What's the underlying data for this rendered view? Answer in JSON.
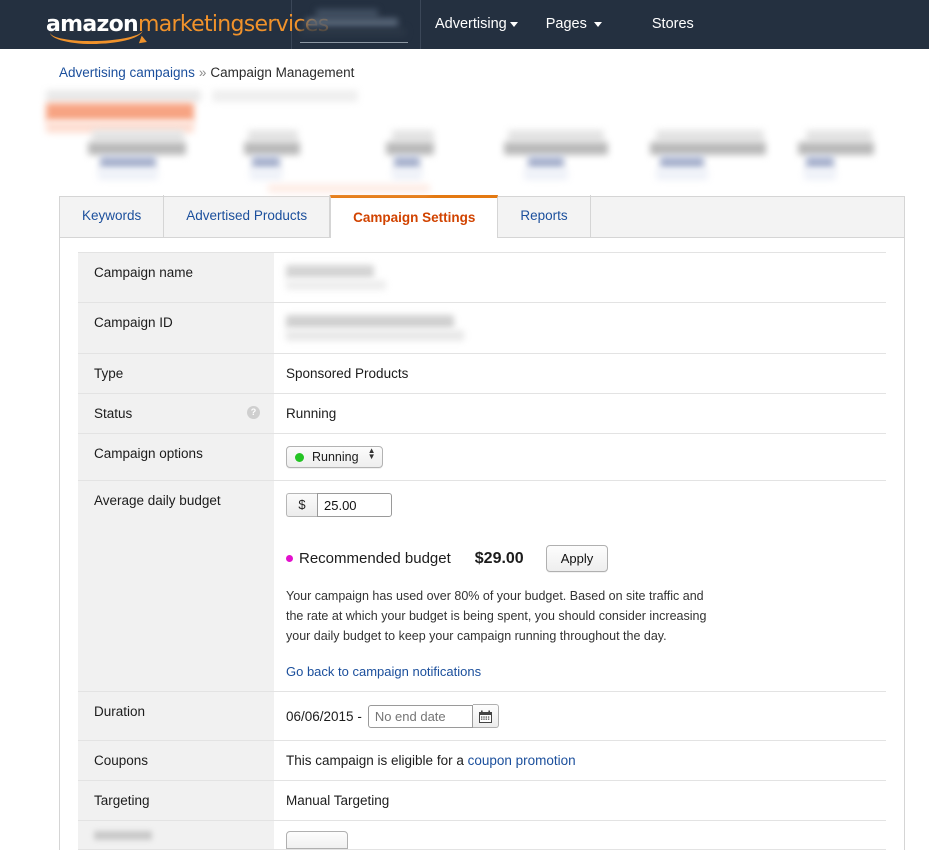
{
  "header": {
    "logo_amazon": "amazon",
    "logo_services": "marketingservices",
    "nav": [
      {
        "label": "Advertising",
        "has_caret": true
      },
      {
        "label": "Pages",
        "has_caret": true
      },
      {
        "label": "Stores",
        "has_caret": false
      }
    ],
    "account_selector_redacted": true
  },
  "breadcrumb": {
    "parent": "Advertising campaigns",
    "separator": "»",
    "current": "Campaign Management"
  },
  "tabs": [
    {
      "label": "Keywords",
      "active": false
    },
    {
      "label": "Advertised Products",
      "active": false
    },
    {
      "label": "Campaign Settings",
      "active": true
    },
    {
      "label": "Reports",
      "active": false
    }
  ],
  "settings": {
    "campaign_name_label": "Campaign name",
    "campaign_id_label": "Campaign ID",
    "type_label": "Type",
    "type_value": "Sponsored Products",
    "status_label": "Status",
    "status_value": "Running",
    "status_help_icon": "question-mark-icon",
    "campaign_options_label": "Campaign options",
    "campaign_options_value": "Running",
    "budget_label": "Average daily budget",
    "budget_currency": "$",
    "budget_value": "25.00",
    "recommended_label": "Recommended budget",
    "recommended_amount": "$29.00",
    "apply_label": "Apply",
    "note_text": "Your campaign has used over 80% of your budget. Based on site traffic and the rate at which your budget is being spent, you should consider increasing your daily budget to keep your campaign running throughout the day.",
    "note_link": "Go back to campaign notifications",
    "duration_label": "Duration",
    "duration_start": "06/06/2015 -",
    "duration_end_placeholder": "No end date",
    "calendar_icon": "calendar-icon",
    "coupons_label": "Coupons",
    "coupons_text": "This campaign is eligible for a ",
    "coupons_link": "coupon promotion",
    "targeting_label": "Targeting",
    "targeting_value": "Manual Targeting"
  },
  "colors": {
    "header_bg": "#243040",
    "accent_orange": "#e47911",
    "active_tab_text": "#d14300",
    "link_blue": "#1b4f9c",
    "status_green": "#24c424",
    "recommend_magenta": "#e310cd",
    "label_cell_bg": "#f1f1f1"
  }
}
